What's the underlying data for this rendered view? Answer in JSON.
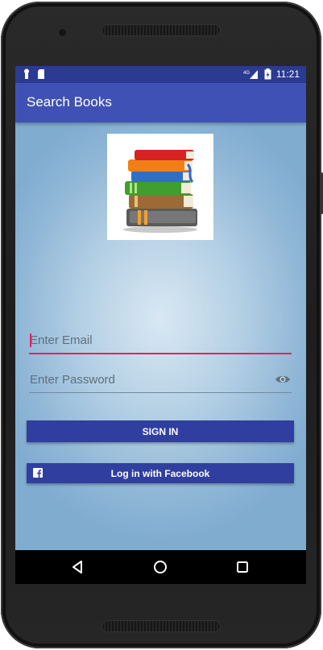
{
  "status_bar": {
    "time": "11:21",
    "network": "4G",
    "left_icons": [
      "notification-icon",
      "sd-card-icon"
    ],
    "right_icons": [
      "signal-icon",
      "battery-icon"
    ]
  },
  "app_bar": {
    "title": "Search Books"
  },
  "logo": {
    "icon": "books-stack-icon"
  },
  "form": {
    "email_placeholder": "Enter Email",
    "email_value": "",
    "password_placeholder": "Enter Password",
    "password_value": "",
    "password_toggle_icon": "eye-icon"
  },
  "buttons": {
    "signin_label": "SIGN IN",
    "facebook_label": "Log in with Facebook",
    "facebook_icon": "facebook-icon"
  },
  "nav_bar": {
    "icons": [
      "back-icon",
      "home-icon",
      "recents-icon"
    ]
  },
  "colors": {
    "status_bar": "#2b3a93",
    "app_bar": "#3f51b5",
    "button": "#303f9f",
    "accent": "#e91e63"
  }
}
